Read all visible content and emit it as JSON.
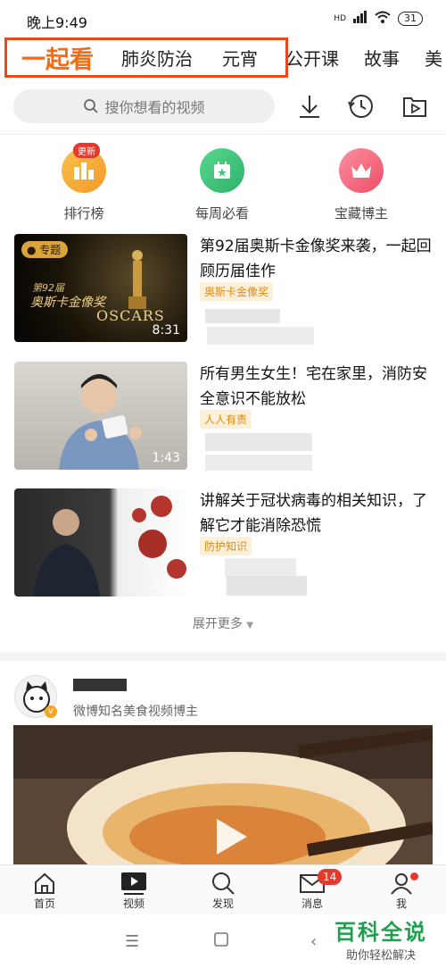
{
  "status": {
    "time": "晚上9:49",
    "battery": "31",
    "network": "HD"
  },
  "tabs": [
    {
      "label": "一起看",
      "active": true
    },
    {
      "label": "肺炎防治"
    },
    {
      "label": "元宵"
    },
    {
      "label": "公开课"
    },
    {
      "label": "故事"
    },
    {
      "label": "美"
    }
  ],
  "search": {
    "placeholder": "搜你想看的视频"
  },
  "shortcuts": [
    {
      "label": "排行榜",
      "badge": "更新",
      "color": "#f7a43a"
    },
    {
      "label": "每周必看",
      "color": "#3cc47c"
    },
    {
      "label": "宝藏博主",
      "color": "#f0607a"
    }
  ],
  "videos": [
    {
      "title": "第92届奥斯卡金像奖来袭，一起回顾历届佳作",
      "tag": "奥斯卡金像奖",
      "duration": "8:31",
      "thumb_badge": "专题",
      "thumb_sub": "第92届",
      "thumb_title": "奥斯卡金像奖",
      "thumb_logo": "OSCARS"
    },
    {
      "title": "所有男生女生！宅在家里，消防安全意识不能放松",
      "tag": "人人有责",
      "duration": "1:43"
    },
    {
      "title": "讲解关于冠状病毒的相关知识，了解它才能消除恐慌",
      "tag": "防护知识",
      "duration": "4:31"
    }
  ],
  "expand_label": "展开更多",
  "author": {
    "desc": "微博知名美食视频博主"
  },
  "bottom_nav": [
    {
      "label": "首页",
      "icon": "home-icon"
    },
    {
      "label": "视频",
      "icon": "video-icon"
    },
    {
      "label": "发现",
      "icon": "search-icon"
    },
    {
      "label": "消息",
      "icon": "mail-icon",
      "badge": "14"
    },
    {
      "label": "我",
      "icon": "user-icon"
    }
  ],
  "watermark": {
    "title": "百科全说",
    "subtitle": "助你轻松解决"
  },
  "colors": {
    "accent": "#f36b14",
    "highlight_border": "#e8481b",
    "badge_red": "#e23a2e",
    "tag_text": "#e08a17"
  }
}
